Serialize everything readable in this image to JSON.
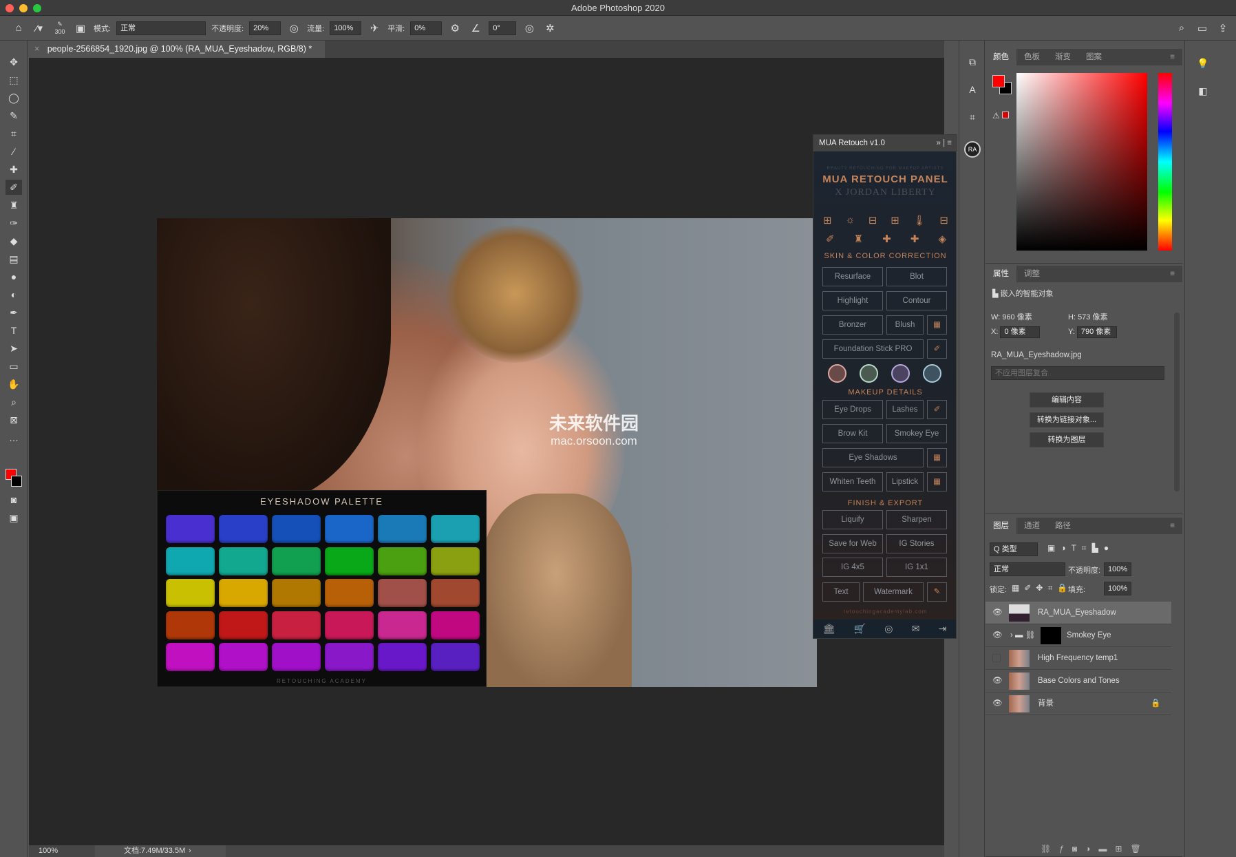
{
  "window": {
    "title": "Adobe Photoshop 2020"
  },
  "options_bar": {
    "brush_size": "300",
    "mode_label": "模式:",
    "mode_value": "正常",
    "opacity_label": "不透明度:",
    "opacity_value": "20%",
    "flow_label": "流量:",
    "flow_value": "100%",
    "smoothing_label": "平滑:",
    "smoothing_value": "0%",
    "angle_value": "0°"
  },
  "document_tab": {
    "close": "×",
    "title": "people-2566854_1920.jpg @ 100% (RA_MUA_Eyeshadow, RGB/8) *"
  },
  "status_bar": {
    "zoom": "100%",
    "doc_size": "文档:7.49M/33.5M",
    "arrow": "›"
  },
  "palette": {
    "title": "EYESHADOW PALETTE",
    "footer": "RETOUCHING ACADEMY",
    "colors": [
      "#4a2fd0",
      "#2a3fc8",
      "#1450b8",
      "#1a66c8",
      "#1a7ab8",
      "#1aa0b0",
      "#10a8b0",
      "#12a890",
      "#10a050",
      "#08a818",
      "#4aa010",
      "#8aa010",
      "#c8c000",
      "#d8a800",
      "#b07800",
      "#b86008",
      "#a05048",
      "#a04830",
      "#b03808",
      "#c01818",
      "#c82040",
      "#c81858",
      "#c82890",
      "#c00880",
      "#c010c0",
      "#b010c8",
      "#a010c8",
      "#8818c8",
      "#6818c8",
      "#5820c0"
    ]
  },
  "watermark": {
    "text": "未来软件园",
    "url": "mac.orsoon.com"
  },
  "mua_panel": {
    "tab": "MUA Retouch v1.0",
    "tagline": "BEAUTY RETOUCHING FOR MAKEUP ARTISTS",
    "title": "MUA RETOUCH PANEL",
    "subtitle": "X JORDAN LIBERTY",
    "section_skin": "SKIN & COLOR CORRECTION",
    "section_makeup": "MAKEUP DETAILS",
    "section_finish": "FINISH & EXPORT",
    "buttons": {
      "resurface": "Resurface",
      "blot": "Blot",
      "highlight": "Highlight",
      "contour": "Contour",
      "bronzer": "Bronzer",
      "blush": "Blush",
      "foundation": "Foundation Stick PRO",
      "eye_drops": "Eye Drops",
      "lashes": "Lashes",
      "brow_kit": "Brow Kit",
      "smokey_eye": "Smokey Eye",
      "eye_shadows": "Eye Shadows",
      "whiten_teeth": "Whiten Teeth",
      "lipstick": "Lipstick",
      "liquify": "Liquify",
      "sharpen": "Sharpen",
      "save_web": "Save for Web",
      "ig_stories": "IG Stories",
      "ig45": "IG 4x5",
      "ig11": "IG 1x1",
      "text": "Text",
      "watermark": "Watermark"
    },
    "swatch_colors": [
      "#6a4a48",
      "#4a5a50",
      "#4a4460",
      "#3e5260"
    ],
    "url": "retouchingacademylab.com",
    "accent": "#c5835a"
  },
  "color_panel": {
    "tabs": [
      "颜色",
      "色板",
      "渐变",
      "图案"
    ],
    "foreground": "#ff0000",
    "background": "#000000"
  },
  "properties_panel": {
    "tabs": [
      "属性",
      "调整"
    ],
    "type": "嵌入的智能对象",
    "w_label": "W:",
    "w_value": "960 像素",
    "h_label": "H:",
    "h_value": "573 像素",
    "x_label": "X:",
    "x_value": "0 像素",
    "y_label": "Y:",
    "y_value": "790 像素",
    "filename": "RA_MUA_Eyeshadow.jpg",
    "comp_placeholder": "不应用图层复合",
    "edit_contents": "编辑内容",
    "convert_linked": "转换为链接对象...",
    "convert_layers": "转换为图层"
  },
  "layers_panel": {
    "tabs": [
      "图层",
      "通道",
      "路径"
    ],
    "filter": "Q 类型",
    "blend": "正常",
    "opacity_label": "不透明度:",
    "opacity_value": "100%",
    "lock_label": "锁定:",
    "fill_label": "填充:",
    "fill_value": "100%",
    "layers": [
      {
        "name": "RA_MUA_Eyeshadow",
        "visible": true,
        "selected": true
      },
      {
        "name": "Smokey Eye",
        "visible": true
      },
      {
        "name": "High Frequency temp1",
        "visible": false
      },
      {
        "name": "Base Colors and Tones",
        "visible": true
      },
      {
        "name": "背景",
        "visible": true,
        "locked": true
      }
    ]
  }
}
